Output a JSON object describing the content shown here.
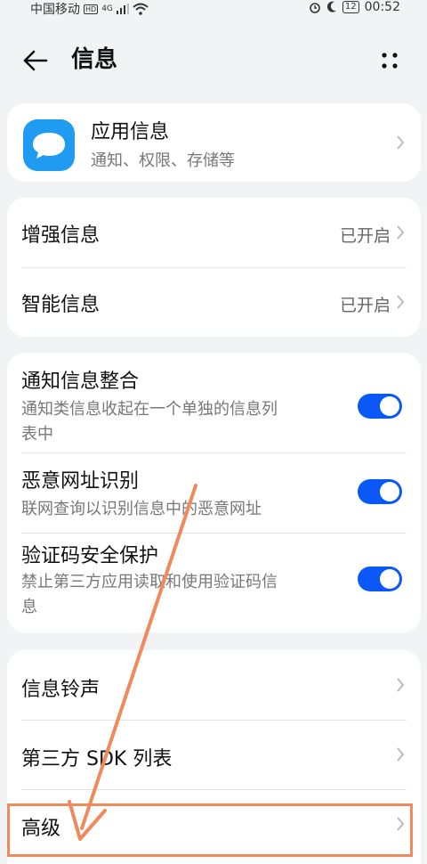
{
  "status_bar": {
    "carrier": "中国移动",
    "hd": "HD",
    "network": "4G",
    "battery": "12",
    "time": "00:52"
  },
  "header": {
    "title": "信息"
  },
  "app_info": {
    "title": "应用信息",
    "subtitle": "通知、权限、存储等"
  },
  "enhanced": [
    {
      "label": "增强信息",
      "value": "已开启"
    },
    {
      "label": "智能信息",
      "value": "已开启"
    }
  ],
  "toggles": [
    {
      "title": "通知信息整合",
      "desc_line1": "通知类信息收起在一个单独的信息列",
      "desc_line2": "表中",
      "on": true
    },
    {
      "title": "恶意网址识别",
      "desc_line1": "联网查询以识别信息中的恶意网址",
      "desc_line2": "",
      "on": true
    },
    {
      "title": "验证码安全保护",
      "desc_line1": "禁止第三方应用读取和使用验证码信",
      "desc_line2": "息",
      "on": true
    }
  ],
  "more": [
    {
      "label": "信息铃声"
    },
    {
      "label": "第三方 SDK 列表"
    },
    {
      "label": "高级"
    }
  ],
  "colors": {
    "accent": "#0a59f7",
    "annotation": "#f08a5d",
    "app_icon": "#1f9cf2"
  }
}
